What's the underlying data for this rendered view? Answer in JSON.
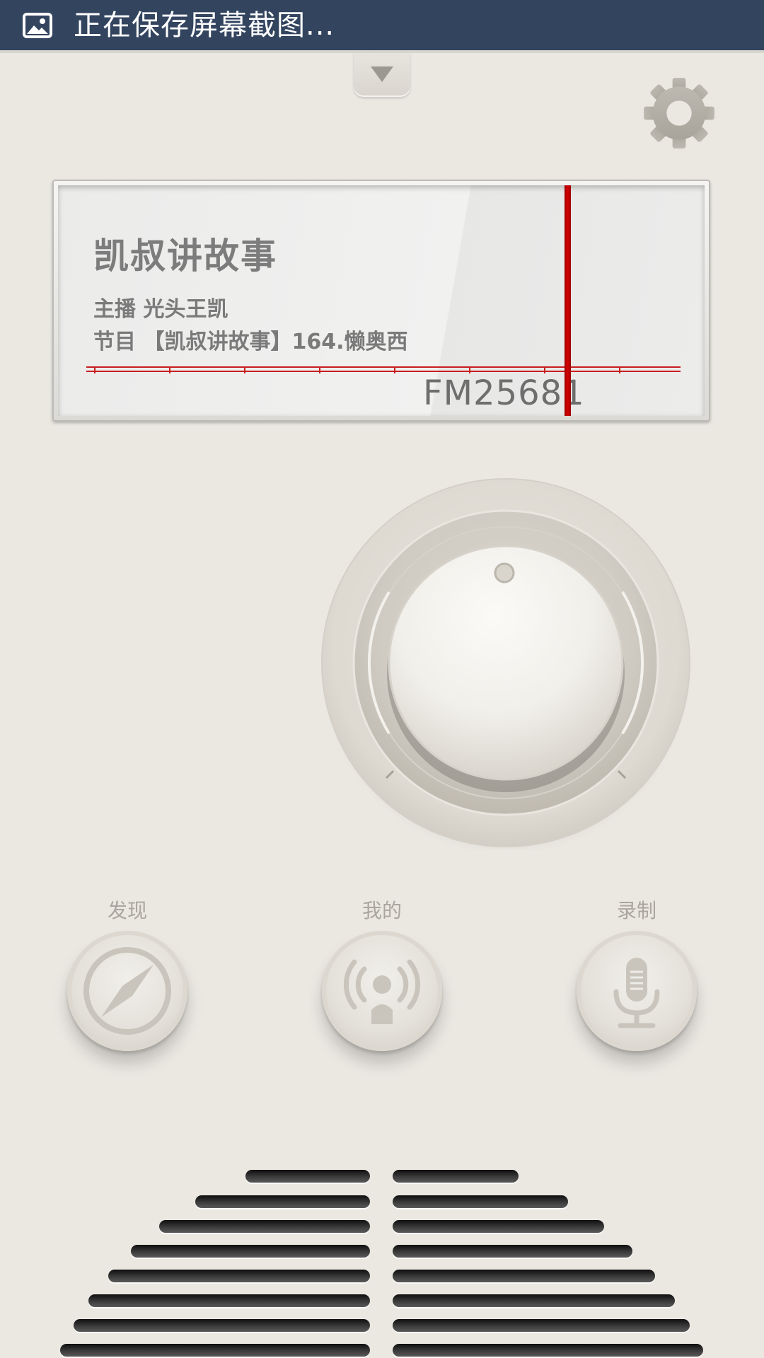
{
  "status_bar": {
    "text": "正在保存屏幕截图..."
  },
  "display": {
    "title": "凯叔讲故事",
    "host": "主播 光头王凯",
    "program": "节目 【凯叔讲故事】164.懒奥西",
    "frequency": "FM25681"
  },
  "nav": {
    "discover_label": "发现",
    "mine_label": "我的",
    "record_label": "录制"
  },
  "icons": {
    "status": "image-icon",
    "pull_tab": "chevron-down-icon",
    "settings": "gear-icon",
    "discover": "compass-icon",
    "mine": "broadcast-icon",
    "record": "microphone-icon"
  },
  "colors": {
    "status_bar": "#33445f",
    "background": "#ebe8e2",
    "needle": "#d00000",
    "scale_line": "#c81e1e"
  }
}
